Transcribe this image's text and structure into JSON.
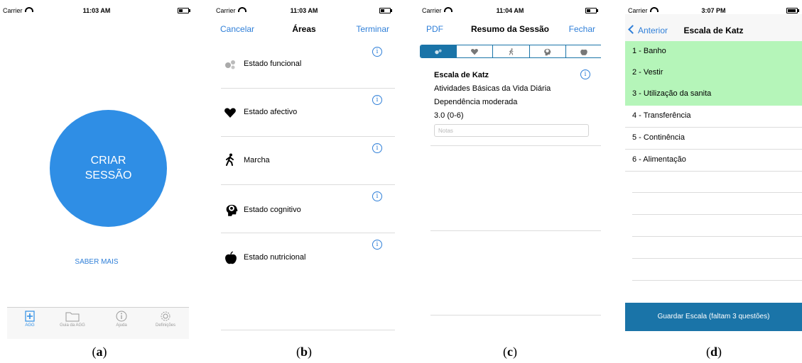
{
  "screens": {
    "a": {
      "status": {
        "carrier": "Carrier",
        "time": "11:03 AM"
      },
      "main_button": "CRIAR\nSESSÃO",
      "saber_mais": "SABER MAIS",
      "tabs": [
        "AGG",
        "Guia da AGG",
        "Ajuda",
        "Definições"
      ]
    },
    "b": {
      "status": {
        "carrier": "Carrier",
        "time": "11:03 AM"
      },
      "nav": {
        "left": "Cancelar",
        "title": "Áreas",
        "right": "Terminar"
      },
      "areas": [
        {
          "label": "Estado funcional",
          "icon": "gears-icon"
        },
        {
          "label": "Estado afectivo",
          "icon": "heart-icon"
        },
        {
          "label": "Marcha",
          "icon": "walking-person-icon"
        },
        {
          "label": "Estado cognitivo",
          "icon": "brain-head-icon"
        },
        {
          "label": "Estado nutricional",
          "icon": "apple-icon"
        }
      ],
      "info_glyph": "i"
    },
    "c": {
      "status": {
        "carrier": "Carrier",
        "time": "11:04 AM"
      },
      "nav": {
        "left": "PDF",
        "title": "Resumo da Sessão",
        "right": "Fechar"
      },
      "segments": [
        "gears-icon",
        "heart-icon",
        "walking-person-icon",
        "brain-head-icon",
        "apple-icon"
      ],
      "result": {
        "name": "Escala de Katz",
        "category": "Atividades Básicas da Vida Diária",
        "interpretation": "Dependência moderada",
        "score": "3.0 (0-6)"
      },
      "notes_placeholder": "Notas"
    },
    "d": {
      "status": {
        "carrier": "Carrier",
        "time": "3:07 PM"
      },
      "nav": {
        "back": "Anterior",
        "title": "Escala de Katz"
      },
      "items": [
        {
          "label": "1 -  Banho",
          "answered": true
        },
        {
          "label": "2 -  Vestir",
          "answered": true
        },
        {
          "label": "3 -  Utilização da sanita",
          "answered": true
        },
        {
          "label": "4 -  Transferência",
          "answered": false
        },
        {
          "label": "5 -  Continência",
          "answered": false
        },
        {
          "label": "6 -  Alimentação",
          "answered": false
        }
      ],
      "save_button": "Guardar Escala (faltam 3 questões)"
    }
  },
  "captions": [
    "a",
    "b",
    "c",
    "d"
  ],
  "colors": {
    "accent": "#2f8ee5",
    "link": "#2f7fd8",
    "dark_blue": "#1a74a8",
    "answered": "#b5f5b9"
  }
}
